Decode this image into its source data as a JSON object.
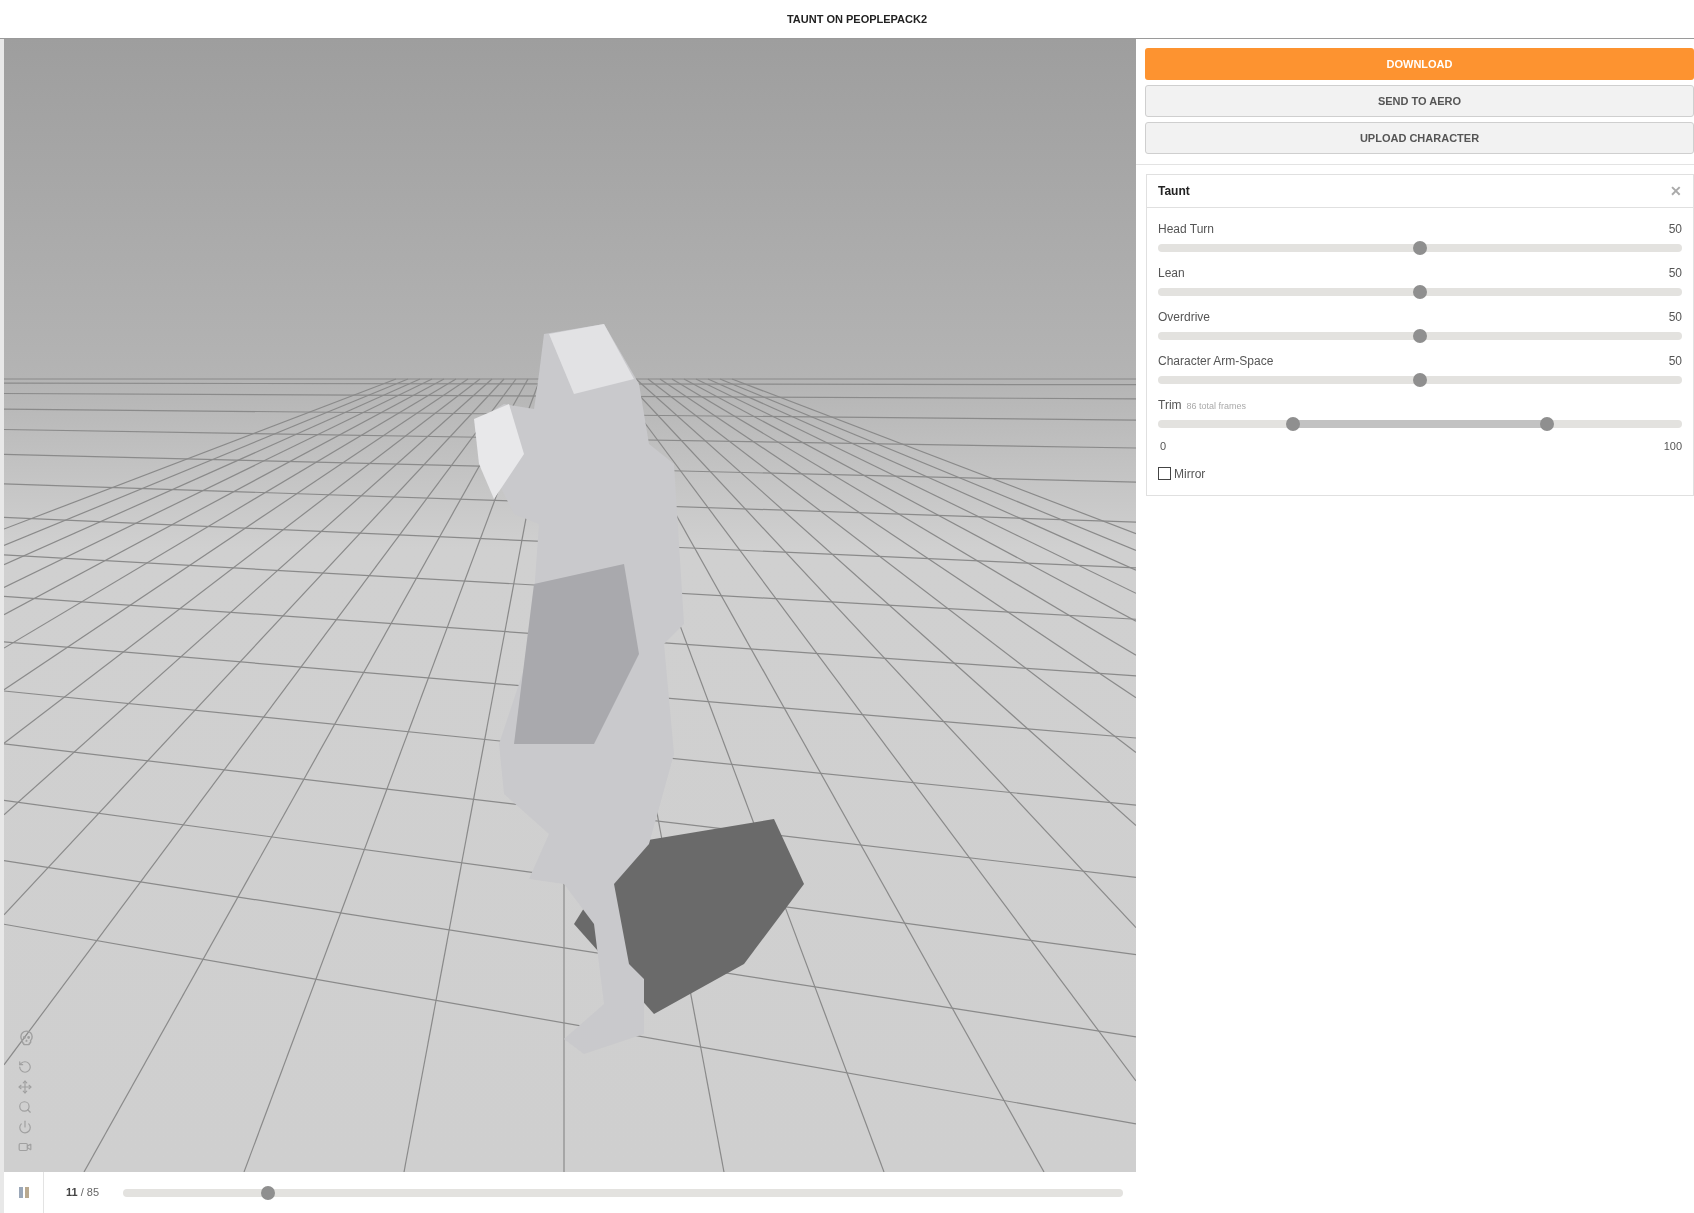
{
  "title": "TAUNT ON PEOPLEPACK2",
  "actions": [
    {
      "label": "DOWNLOAD",
      "kind": "primary"
    },
    {
      "label": "SEND TO AERO",
      "kind": "secondary"
    },
    {
      "label": "UPLOAD CHARACTER",
      "kind": "secondary"
    }
  ],
  "panel": {
    "title": "Taunt",
    "close": "✕",
    "sliders": [
      {
        "label": "Head Turn",
        "reading": "50",
        "level": 0.5
      },
      {
        "label": "Lean",
        "reading": "50",
        "level": 0.5
      },
      {
        "label": "Overdrive",
        "reading": "50",
        "level": 0.5
      },
      {
        "label": "Character Arm-Space",
        "reading": "50",
        "level": 0.5
      }
    ],
    "trim": {
      "label": "Trim",
      "note": "86 total frames",
      "thumbs": [
        {
          "level": 0.257
        },
        {
          "level": 0.743
        }
      ],
      "min": "0",
      "max": "100"
    },
    "mirror": {
      "label": "Mirror",
      "checked": false
    }
  },
  "timeline": {
    "playing": true,
    "frame": "11",
    "total": "/ 85",
    "level": 0.145
  }
}
